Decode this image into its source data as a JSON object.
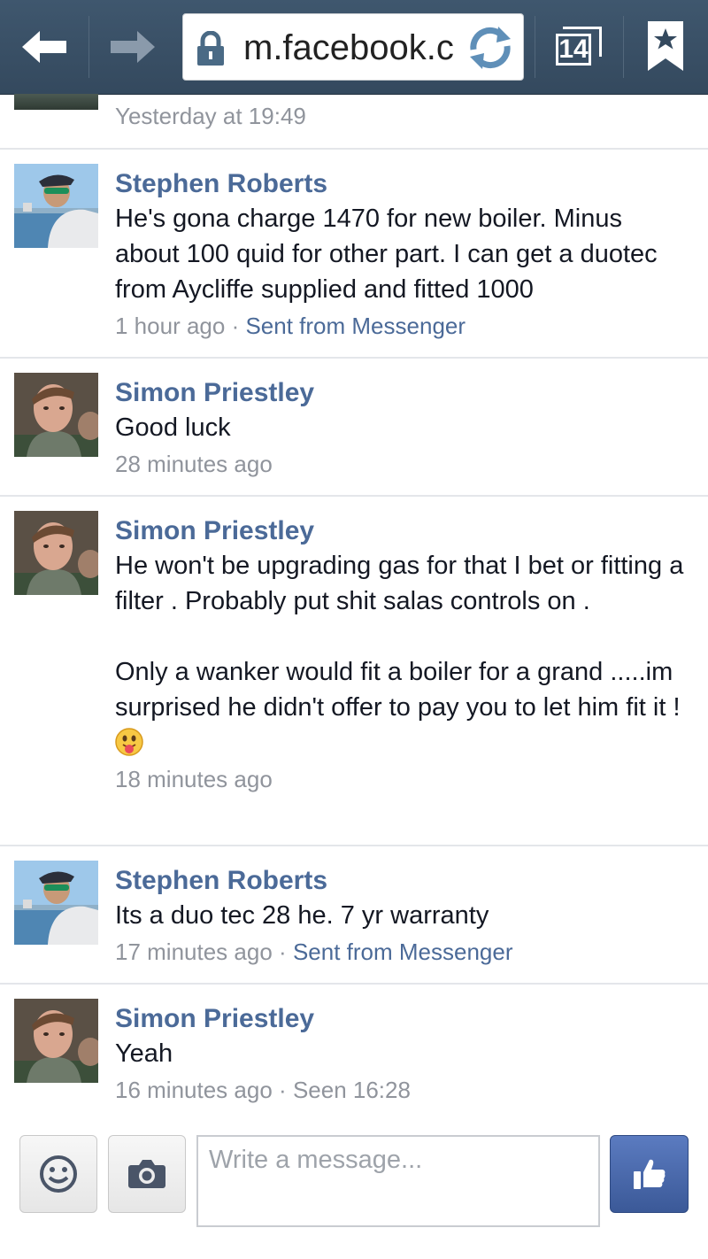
{
  "browser": {
    "url": "m.facebook.c",
    "tab_count": "14",
    "toolbar_color": "#3b5268"
  },
  "thread": {
    "previous_time": "Yesterday at 19:49",
    "messages": [
      {
        "author": "Stephen Roberts",
        "avatar": "stephen-avatar",
        "text": "He's gona charge 1470 for new boiler. Minus about 100 quid for other part. I can get a duotec from Aycliffe supplied and fitted 1000",
        "time": "1 hour ago",
        "separator": "·",
        "source": "Sent from Messenger"
      },
      {
        "author": "Simon Priestley",
        "avatar": "simon-avatar",
        "text": "Good luck",
        "time": "28 minutes ago"
      },
      {
        "author": "Simon Priestley",
        "avatar": "simon-avatar",
        "text_part1": "He won't be upgrading gas for that I bet or fitting a filter . Probably put shit salas controls on .",
        "text_part2": "Only a wanker would fit a boiler for a grand .....im surprised he didn't offer to pay you to let him fit it ! ",
        "emoji": "tongue-out-emoji",
        "time": "18 minutes ago"
      },
      {
        "author": "Stephen Roberts",
        "avatar": "stephen-avatar",
        "text": "Its a duo tec 28 he. 7 yr warranty",
        "time": "17 minutes ago",
        "separator": "·",
        "source": "Sent from Messenger"
      },
      {
        "author": "Simon Priestley",
        "avatar": "simon-avatar",
        "text": "Yeah",
        "time": "16 minutes ago",
        "separator": "·",
        "seen": "Seen 16:28"
      }
    ]
  },
  "composer": {
    "placeholder": "Write a message...",
    "emoji_icon": "smiley-icon",
    "photo_icon": "camera-icon",
    "like_icon": "thumbs-up-icon",
    "like_color": "#3b5998"
  }
}
